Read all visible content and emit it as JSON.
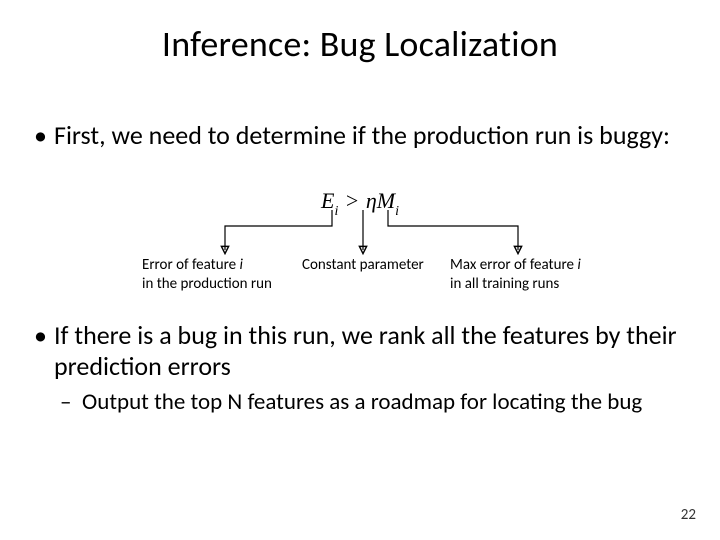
{
  "title": "Inference: Bug Localization",
  "bullet1": "First, we need to determine if the production run is buggy:",
  "formula": {
    "E": "E",
    "i": "i",
    "gt": ">",
    "eta": "η",
    "M": "M"
  },
  "labels": {
    "lab1a": "Error of feature ",
    "lab1i": "i",
    "lab1b": " in the production run",
    "lab2": "Constant parameter",
    "lab3a": "Max error of feature ",
    "lab3i": "i",
    "lab3b": " in all training runs"
  },
  "bullet2": "If there is a bug in this run, we rank all the features by their prediction errors",
  "sub1": "Output the top N features as a roadmap for locating the bug",
  "pagenum": "22"
}
